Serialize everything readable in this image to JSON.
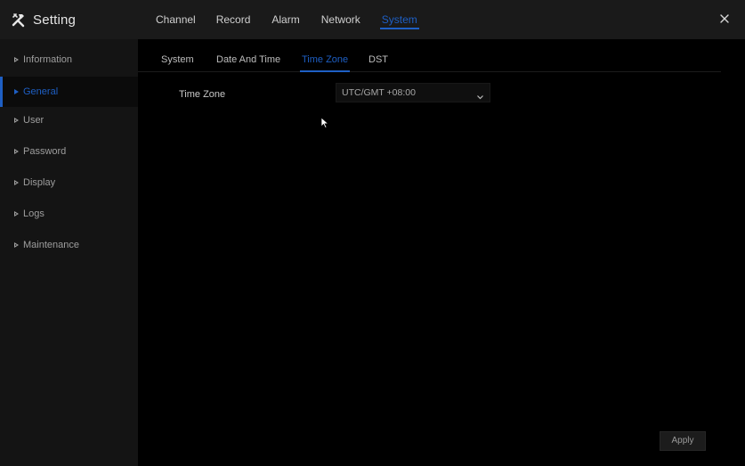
{
  "app": {
    "title": "Setting",
    "icon": "tools-icon"
  },
  "main_tabs": [
    {
      "label": "Channel",
      "active": false
    },
    {
      "label": "Record",
      "active": false
    },
    {
      "label": "Alarm",
      "active": false
    },
    {
      "label": "Network",
      "active": false
    },
    {
      "label": "System",
      "active": true
    }
  ],
  "close": {
    "icon": "close-icon"
  },
  "sidebar": {
    "items": [
      {
        "label": "Information",
        "active": false
      },
      {
        "label": "General",
        "active": true
      },
      {
        "label": "User",
        "active": false
      },
      {
        "label": "Password",
        "active": false
      },
      {
        "label": "Display",
        "active": false
      },
      {
        "label": "Logs",
        "active": false
      },
      {
        "label": "Maintenance",
        "active": false
      }
    ]
  },
  "sub_tabs": [
    {
      "label": "System",
      "active": false
    },
    {
      "label": "Date And Time",
      "active": false
    },
    {
      "label": "Time Zone",
      "active": true
    },
    {
      "label": "DST",
      "active": false
    }
  ],
  "form": {
    "time_zone_label": "Time Zone",
    "time_zone_value": "UTC/GMT +08:00"
  },
  "actions": {
    "apply_label": "Apply"
  },
  "colors": {
    "accent": "#1e5fc4",
    "background": "#000000",
    "titlebar": "#1a1a1a",
    "sidebar": "#141414"
  }
}
